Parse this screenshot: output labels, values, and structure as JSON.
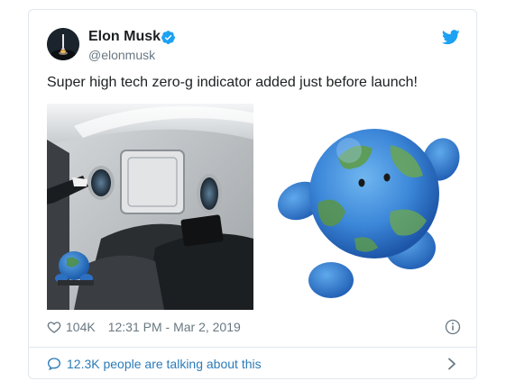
{
  "tweet": {
    "author_name": "Elon Musk",
    "author_handle": "@elonmusk",
    "verified": true,
    "text": "Super high tech zero-g indicator added just before launch!",
    "likes": "104K",
    "timestamp": "12:31 PM - Mar 2, 2019",
    "conversation": "12.3K people are talking about this"
  },
  "media": {
    "left_image": "spacecraft-cabin-with-globe-plush",
    "right_image": "earth-globe-plush-toy"
  },
  "icons": {
    "verified": "verified-badge-icon",
    "brand": "twitter-bird-icon",
    "like": "heart-icon",
    "info": "info-icon",
    "conversation": "speech-bubble-icon",
    "more": "chevron-right-icon"
  },
  "colors": {
    "accent": "#1da1f2",
    "link": "#2b7bb9",
    "text": "#1c2022",
    "muted": "#697882",
    "border": "#e1e8ed"
  }
}
